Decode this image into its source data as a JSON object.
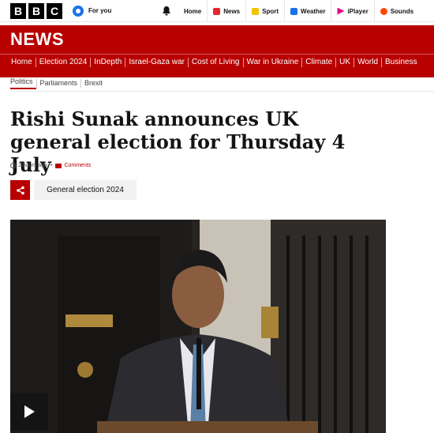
{
  "top": {
    "logo_letters": [
      "B",
      "B",
      "C"
    ],
    "for_you": "For you",
    "nav": [
      {
        "label": "Home",
        "icon": "home",
        "color": ""
      },
      {
        "label": "News",
        "icon": "news-icon",
        "color": "#e6272d"
      },
      {
        "label": "Sport",
        "icon": "sport-icon",
        "color": "#f2c400"
      },
      {
        "label": "Weather",
        "icon": "weather-icon",
        "color": "#1a73e8"
      },
      {
        "label": "iPlayer",
        "icon": "iplayer-icon",
        "color": "#e4088e"
      },
      {
        "label": "Sounds",
        "icon": "sounds-icon",
        "color": "#ff4800"
      }
    ]
  },
  "news": {
    "title": "NEWS",
    "nav": [
      "Home",
      "Election 2024",
      "InDepth",
      "Israel-Gaza war",
      "Cost of Living",
      "War in Ukraine",
      "Climate",
      "UK",
      "World",
      "Business"
    ],
    "subnav": [
      "Politics",
      "Parliaments",
      "Brexit"
    ]
  },
  "article": {
    "headline": "Rishi Sunak announces UK general election for Thursday 4 July",
    "time": "2 hours ago",
    "comments": "Comments",
    "tag": "General election 2024"
  },
  "colors": {
    "brand_red": "#b80000"
  }
}
